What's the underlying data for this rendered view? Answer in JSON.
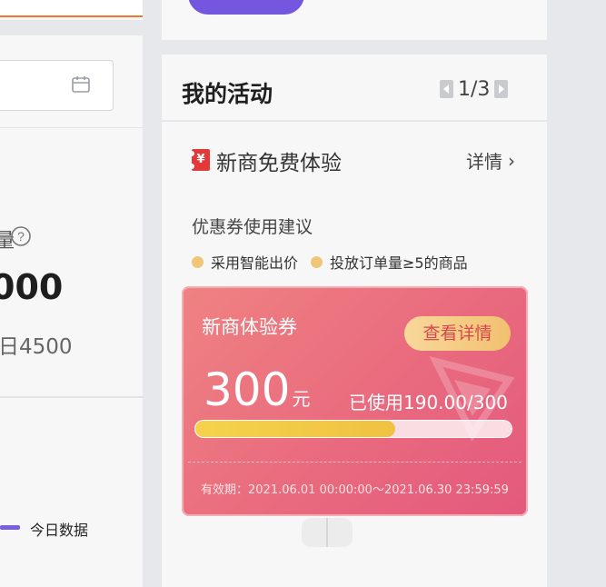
{
  "left": {
    "metric_label_fragment": "量",
    "metric_value": "000",
    "metric_compare": "日4500",
    "legend_label": "今日数据"
  },
  "activity": {
    "title": "我的活动",
    "pager": "1/3",
    "promo_title": "新商免费体验",
    "details_label": "详情",
    "details_chevron": "›",
    "ticket_symbol": "¥",
    "suggest_title": "优惠券使用建议",
    "tips": [
      "采用智能出价",
      "投放订单量≥5的商品"
    ],
    "coupon": {
      "name": "新商体验券",
      "view_button": "查看详情",
      "amount": "300",
      "unit": "元",
      "used_text": "已使用190.00/300",
      "used": 190,
      "total": 300,
      "validity": "有效期：2021.06.01 00:00:00～2021.06.30 23:59:59"
    }
  },
  "colors": {
    "accent_purple": "#7556de",
    "orange_outline": "#e9792f",
    "coupon_start": "#ef8282",
    "coupon_end": "#e4597d",
    "progress_fill": "#f6d24c"
  }
}
